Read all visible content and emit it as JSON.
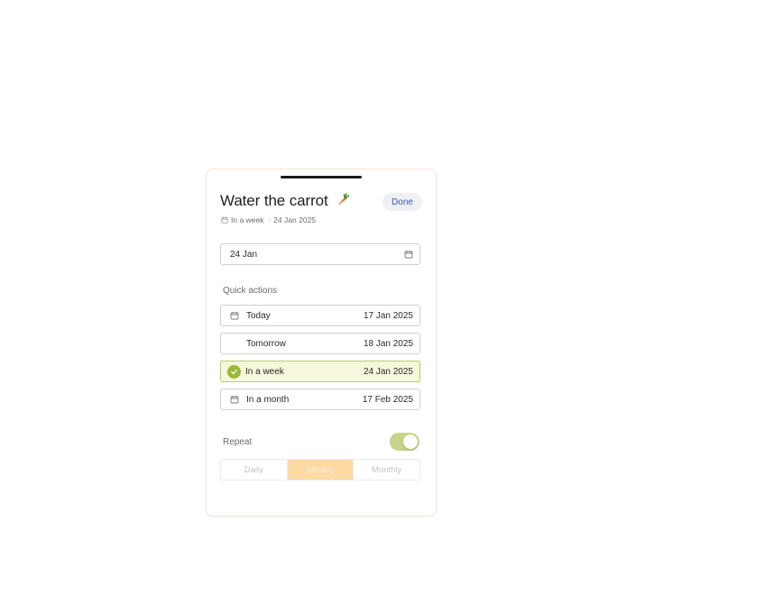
{
  "task": {
    "title": "Water the carrot",
    "title_emoji_icon": "carrot-icon",
    "done_label": "Done",
    "meta_relative": "In a week",
    "meta_separator": "·",
    "meta_date": "24 Jan 2025"
  },
  "date_field": {
    "value": "24 Jan",
    "icon": "calendar-icon"
  },
  "quick_actions": {
    "label": "Quick actions",
    "items": [
      {
        "label": "Today",
        "date": "17 Jan 2025",
        "icon": "calendar-icon"
      },
      {
        "label": "Tomorrow",
        "date": "18 Jan 2025",
        "icon": ""
      },
      {
        "label": "In a week",
        "date": "24 Jan 2025",
        "icon": "check-circle-icon",
        "selected": true
      },
      {
        "label": "In a month",
        "date": "17 Feb 2025",
        "icon": "calendar-icon"
      }
    ]
  },
  "repeat": {
    "label": "Repeat",
    "enabled": true,
    "options": [
      "Daily",
      "Weekly",
      "Monthly"
    ],
    "selected": "Weekly"
  },
  "colors": {
    "accent_green": "#9bb83a",
    "selected_bg": "#f5f8dc",
    "toggle_on": "#c5d58a",
    "segment_active": "#fdd9a4",
    "done_text": "#3b5ba8"
  }
}
